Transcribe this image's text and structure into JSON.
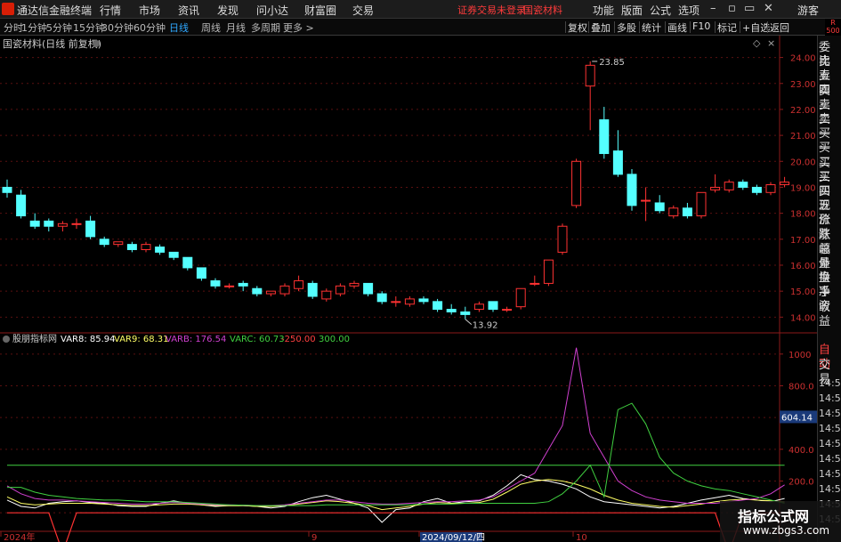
{
  "menubar": {
    "app_title": "通达信金融终端",
    "menus": [
      "行情",
      "市场",
      "资讯",
      "发现",
      "问小达",
      "财富圈",
      "交易"
    ],
    "warning": "证券交易未登录",
    "stock_name": "国瓷材料",
    "right_menus": [
      "功能",
      "版面",
      "公式",
      "选项"
    ],
    "guest": "游客"
  },
  "periodbar": {
    "periods": [
      "分时",
      "1分钟",
      "5分钟",
      "15分钟",
      "30分钟",
      "60分钟",
      "日线",
      "周线",
      "月线",
      "多周期",
      "更多 >"
    ],
    "active_index": 6,
    "tools": [
      "复权",
      "叠加",
      "多股",
      "统计",
      "画线",
      "F10",
      "标记",
      "+自选",
      "返回"
    ]
  },
  "r_tag": {
    "l1": "R",
    "l2": "500"
  },
  "main_chart": {
    "title": "国瓷材料(日线 前复权)",
    "price_ticks": [
      "24.00",
      "23.00",
      "22.00",
      "21.00",
      "20.00",
      "19.00",
      "18.00",
      "17.00",
      "16.00",
      "15.00",
      "14.00"
    ],
    "high_label": "23.85",
    "low_label": "13.92"
  },
  "indicator": {
    "name": "股朋指标网",
    "legend": [
      {
        "text": "VAR8: 85.94",
        "color": "#ffffff"
      },
      {
        "text": "VAR9: 68.31",
        "color": "#ffff66"
      },
      {
        "text": "VARB: 176.54",
        "color": "#d040d0"
      },
      {
        "text": "VARC: 60.73",
        "color": "#40d040"
      },
      {
        "text": "-250.00",
        "color": "#ff4040"
      },
      {
        "text": "300.00",
        "color": "#40d040"
      }
    ],
    "ticks": [
      "1000",
      "800.0",
      "600.0",
      "400.0",
      "200.0",
      "0.00"
    ],
    "cursor_value": "604.14"
  },
  "date_axis": {
    "labels": [
      "2024年",
      "9",
      "2024/09/12/四",
      "10"
    ]
  },
  "side_panel": {
    "items": [
      "委比",
      "卖五",
      "卖四",
      "卖三",
      "卖二",
      "卖一",
      "买一",
      "买二",
      "买三",
      "买四",
      "买五",
      "现价",
      "涨跌",
      "涨幅",
      "总量",
      "外盘",
      "换手",
      "净资",
      "收益"
    ],
    "auto_label": "自动",
    "trade_label": "交易",
    "times": [
      "14:56",
      "14:56",
      "14:56",
      "14:56",
      "14:56",
      "14:56",
      "14:56",
      "14:56",
      "14:56",
      "14:56"
    ]
  },
  "watermark": {
    "line1": "指标公式网",
    "line2": "www.zbgs3.com"
  },
  "colors": {
    "up": "#ff3232",
    "down": "#54ffff",
    "accent": "#2fa8ff",
    "var8": "#ffffff",
    "var9": "#ffff66",
    "varb": "#d040d0",
    "varc": "#40d040"
  },
  "chart_data": {
    "type": "candlestick",
    "ylim": [
      13.6,
      24.5
    ],
    "indicator_ylim": [
      -100,
      1100
    ],
    "candles": [
      {
        "o": 19.0,
        "h": 19.3,
        "c": 18.8,
        "l": 18.6
      },
      {
        "o": 18.7,
        "h": 18.9,
        "c": 17.9,
        "l": 17.8
      },
      {
        "o": 17.7,
        "h": 18.0,
        "c": 17.5,
        "l": 17.4
      },
      {
        "o": 17.7,
        "h": 17.8,
        "c": 17.5,
        "l": 17.3
      },
      {
        "o": 17.5,
        "h": 17.7,
        "c": 17.6,
        "l": 17.3
      },
      {
        "o": 17.6,
        "h": 17.8,
        "c": 17.6,
        "l": 17.4
      },
      {
        "o": 17.7,
        "h": 17.9,
        "c": 17.1,
        "l": 17.0
      },
      {
        "o": 17.0,
        "h": 17.1,
        "c": 16.8,
        "l": 16.7
      },
      {
        "o": 16.8,
        "h": 16.9,
        "c": 16.9,
        "l": 16.7
      },
      {
        "o": 16.8,
        "h": 16.9,
        "c": 16.6,
        "l": 16.5
      },
      {
        "o": 16.6,
        "h": 16.9,
        "c": 16.8,
        "l": 16.5
      },
      {
        "o": 16.7,
        "h": 16.8,
        "c": 16.5,
        "l": 16.4
      },
      {
        "o": 16.5,
        "h": 16.5,
        "c": 16.3,
        "l": 16.2
      },
      {
        "o": 16.3,
        "h": 16.3,
        "c": 15.9,
        "l": 15.8
      },
      {
        "o": 15.9,
        "h": 15.9,
        "c": 15.5,
        "l": 15.4
      },
      {
        "o": 15.4,
        "h": 15.5,
        "c": 15.2,
        "l": 15.1
      },
      {
        "o": 15.2,
        "h": 15.3,
        "c": 15.2,
        "l": 15.1
      },
      {
        "o": 15.3,
        "h": 15.4,
        "c": 15.2,
        "l": 15.0
      },
      {
        "o": 15.1,
        "h": 15.2,
        "c": 14.9,
        "l": 14.8
      },
      {
        "o": 14.9,
        "h": 15.0,
        "c": 15.0,
        "l": 14.8
      },
      {
        "o": 14.9,
        "h": 15.3,
        "c": 15.2,
        "l": 14.8
      },
      {
        "o": 15.1,
        "h": 15.6,
        "c": 15.4,
        "l": 15.0
      },
      {
        "o": 15.3,
        "h": 15.4,
        "c": 14.8,
        "l": 14.7
      },
      {
        "o": 14.7,
        "h": 15.1,
        "c": 15.0,
        "l": 14.6
      },
      {
        "o": 14.9,
        "h": 15.3,
        "c": 15.2,
        "l": 14.8
      },
      {
        "o": 15.2,
        "h": 15.4,
        "c": 15.3,
        "l": 15.1
      },
      {
        "o": 15.3,
        "h": 15.3,
        "c": 14.9,
        "l": 14.8
      },
      {
        "o": 14.9,
        "h": 15.0,
        "c": 14.6,
        "l": 14.5
      },
      {
        "o": 14.6,
        "h": 14.8,
        "c": 14.6,
        "l": 14.4
      },
      {
        "o": 14.5,
        "h": 14.8,
        "c": 14.7,
        "l": 14.4
      },
      {
        "o": 14.7,
        "h": 14.8,
        "c": 14.6,
        "l": 14.5
      },
      {
        "o": 14.6,
        "h": 14.7,
        "c": 14.3,
        "l": 14.2
      },
      {
        "o": 14.3,
        "h": 14.5,
        "c": 14.2,
        "l": 14.1
      },
      {
        "o": 14.2,
        "h": 14.4,
        "c": 14.1,
        "l": 13.92
      },
      {
        "o": 14.3,
        "h": 14.6,
        "c": 14.5,
        "l": 14.2
      },
      {
        "o": 14.6,
        "h": 14.6,
        "c": 14.3,
        "l": 14.2
      },
      {
        "o": 14.3,
        "h": 14.4,
        "c": 14.3,
        "l": 14.2
      },
      {
        "o": 14.4,
        "h": 15.1,
        "c": 15.1,
        "l": 14.3
      },
      {
        "o": 15.3,
        "h": 15.6,
        "c": 15.3,
        "l": 15.2
      },
      {
        "o": 15.3,
        "h": 16.2,
        "c": 16.2,
        "l": 15.2
      },
      {
        "o": 16.5,
        "h": 17.6,
        "c": 17.5,
        "l": 16.4
      },
      {
        "o": 18.3,
        "h": 20.1,
        "c": 20.0,
        "l": 18.2
      },
      {
        "o": 22.9,
        "h": 23.85,
        "c": 23.7,
        "l": 21.2
      },
      {
        "o": 21.6,
        "h": 22.1,
        "c": 20.3,
        "l": 20.1
      },
      {
        "o": 20.4,
        "h": 21.2,
        "c": 19.5,
        "l": 19.4
      },
      {
        "o": 19.5,
        "h": 19.7,
        "c": 18.3,
        "l": 18.1
      },
      {
        "o": 18.5,
        "h": 19.0,
        "c": 18.5,
        "l": 17.7
      },
      {
        "o": 18.4,
        "h": 18.7,
        "c": 18.1,
        "l": 18.0
      },
      {
        "o": 17.9,
        "h": 18.3,
        "c": 18.2,
        "l": 17.8
      },
      {
        "o": 18.2,
        "h": 18.4,
        "c": 17.9,
        "l": 17.8
      },
      {
        "o": 17.9,
        "h": 18.8,
        "c": 18.8,
        "l": 17.8
      },
      {
        "o": 18.9,
        "h": 19.5,
        "c": 19.0,
        "l": 18.8
      },
      {
        "o": 18.9,
        "h": 19.3,
        "c": 19.2,
        "l": 18.8
      },
      {
        "o": 19.2,
        "h": 19.3,
        "c": 19.0,
        "l": 18.9
      },
      {
        "o": 19.0,
        "h": 19.1,
        "c": 18.8,
        "l": 18.7
      },
      {
        "o": 18.8,
        "h": 19.2,
        "c": 19.1,
        "l": 18.7
      },
      {
        "o": 19.1,
        "h": 19.4,
        "c": 19.2,
        "l": 19.0
      }
    ],
    "series": [
      {
        "name": "VAR8",
        "values": [
          80,
          40,
          30,
          60,
          70,
          75,
          65,
          60,
          45,
          40,
          40,
          60,
          75,
          60,
          50,
          40,
          45,
          45,
          40,
          30,
          40,
          70,
          95,
          110,
          85,
          60,
          30,
          -60,
          20,
          30,
          70,
          90,
          60,
          70,
          75,
          110,
          170,
          240,
          210,
          200,
          180,
          150,
          100,
          70,
          60,
          50,
          40,
          30,
          40,
          60,
          80,
          95,
          110,
          90,
          80,
          70,
          90
        ]
      },
      {
        "name": "VAR9",
        "values": [
          100,
          60,
          50,
          55,
          60,
          60,
          60,
          55,
          50,
          45,
          45,
          50,
          55,
          55,
          50,
          45,
          45,
          45,
          40,
          40,
          45,
          55,
          65,
          75,
          70,
          60,
          45,
          20,
          30,
          40,
          55,
          65,
          60,
          60,
          65,
          85,
          130,
          180,
          200,
          210,
          200,
          180,
          150,
          110,
          80,
          60,
          50,
          40,
          35,
          45,
          55,
          70,
          80,
          85,
          80,
          75,
          68
        ]
      },
      {
        "name": "VARB",
        "values": [
          170,
          120,
          90,
          80,
          80,
          75,
          70,
          65,
          60,
          55,
          55,
          60,
          65,
          60,
          55,
          50,
          50,
          48,
          45,
          45,
          50,
          60,
          70,
          80,
          80,
          70,
          60,
          55,
          55,
          60,
          65,
          70,
          70,
          75,
          80,
          100,
          150,
          200,
          250,
          400,
          550,
          1040,
          500,
          350,
          200,
          140,
          100,
          80,
          70,
          60,
          60,
          60,
          70,
          80,
          90,
          120,
          176
        ]
      },
      {
        "name": "VARC",
        "values": [
          160,
          160,
          130,
          110,
          100,
          90,
          85,
          80,
          80,
          75,
          70,
          70,
          70,
          65,
          60,
          55,
          50,
          48,
          45,
          45,
          45,
          45,
          45,
          50,
          50,
          50,
          50,
          50,
          50,
          50,
          55,
          55,
          55,
          60,
          60,
          60,
          60,
          60,
          60,
          70,
          120,
          200,
          300,
          100,
          650,
          690,
          560,
          350,
          250,
          200,
          170,
          150,
          140,
          120,
          100,
          80,
          60
        ]
      },
      {
        "name": "-250.00",
        "values": [
          0,
          0,
          0,
          0,
          -250,
          0,
          0,
          0,
          0,
          0,
          0,
          0,
          0,
          0,
          0,
          0,
          0,
          0,
          0,
          0,
          0,
          0,
          0,
          0,
          0,
          0,
          0,
          0,
          0,
          0,
          0,
          0,
          0,
          0,
          0,
          0,
          0,
          0,
          0,
          0,
          0,
          0,
          0,
          0,
          0,
          0,
          0,
          0,
          0,
          0,
          0,
          0,
          -250,
          0,
          0,
          0,
          0
        ]
      },
      {
        "name": "300.00",
        "values": [
          300,
          300,
          300,
          300,
          300,
          300,
          300,
          300,
          300,
          300,
          300,
          300,
          300,
          300,
          300,
          300,
          300,
          300,
          300,
          300,
          300,
          300,
          300,
          300,
          300,
          300,
          300,
          300,
          300,
          300,
          300,
          300,
          300,
          300,
          300,
          300,
          300,
          300,
          300,
          300,
          300,
          300,
          300,
          300,
          300,
          300,
          300,
          300,
          300,
          300,
          300,
          300,
          300,
          300,
          300,
          300,
          300
        ]
      }
    ]
  }
}
